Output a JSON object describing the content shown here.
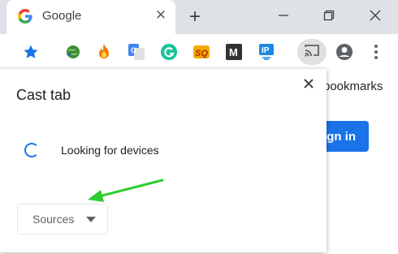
{
  "tab": {
    "title": "Google",
    "close_glyph": "✕",
    "favicon": "google-g-icon"
  },
  "tabstrip": {
    "new_tab_glyph": "+"
  },
  "window_controls": [
    "minimize-icon",
    "restore-icon",
    "close-icon"
  ],
  "toolbar": {
    "icons": [
      "bookmark-star-icon",
      "idm-globe-icon",
      "flame-extension-icon",
      "google-translate-icon",
      "grammarly-icon",
      "seo-extension-icon",
      "m-extension-icon",
      "ip-extension-icon",
      "cast-icon",
      "profile-icon",
      "menu-icon"
    ],
    "ip_label": "IP",
    "m_label": "M",
    "seo_label": "SQ",
    "translate_label": "G"
  },
  "page": {
    "bookmarks_link": "bookmarks",
    "signin_label": "gn in"
  },
  "colors": {
    "accent": "#1a73e8",
    "arrow": "#2ecc2e",
    "tabstrip": "#dee1e6"
  },
  "cast_dialog": {
    "title": "Cast tab",
    "status": "Looking for devices",
    "sources_label": "Sources"
  }
}
